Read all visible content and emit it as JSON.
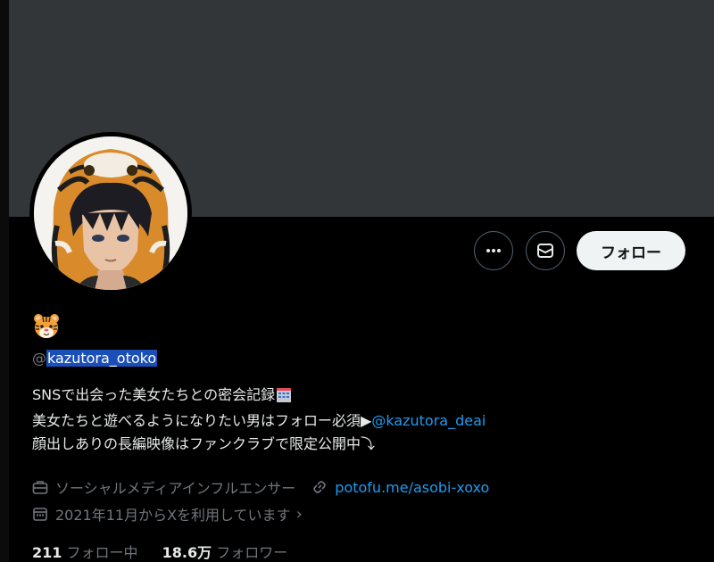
{
  "profile": {
    "handle_prefix": "@",
    "handle": "kazutora_otoko",
    "name_emoji": "tiger-face",
    "bio_line1": "SNSで出会った美女たちとの密会記録",
    "bio_line2_text": "美女たちと遊べるようになりたい男はフォロー必須▶",
    "bio_line2_link": "@kazutora_deai",
    "bio_line3": "顔出しありの長編映像はファンクラブで限定公開中⤵"
  },
  "actions": {
    "more_icon": "ellipsis-icon",
    "message_icon": "envelope-icon",
    "follow_label": "フォロー"
  },
  "meta": {
    "category": "ソーシャルメディアインフルエンサー",
    "website": "potofu.me/asobi-xoxo",
    "joined": "2021年11月からXを利用しています",
    "joined_chevron": "›"
  },
  "stats": {
    "following_count": "211",
    "following_label": "フォロー中",
    "followers_count": "18.6万",
    "followers_label": "フォロワー"
  },
  "colors": {
    "background": "#000000",
    "banner": "#333639",
    "link": "#1d9bf0",
    "muted": "#71767b",
    "selection": "#1b4fb8"
  }
}
